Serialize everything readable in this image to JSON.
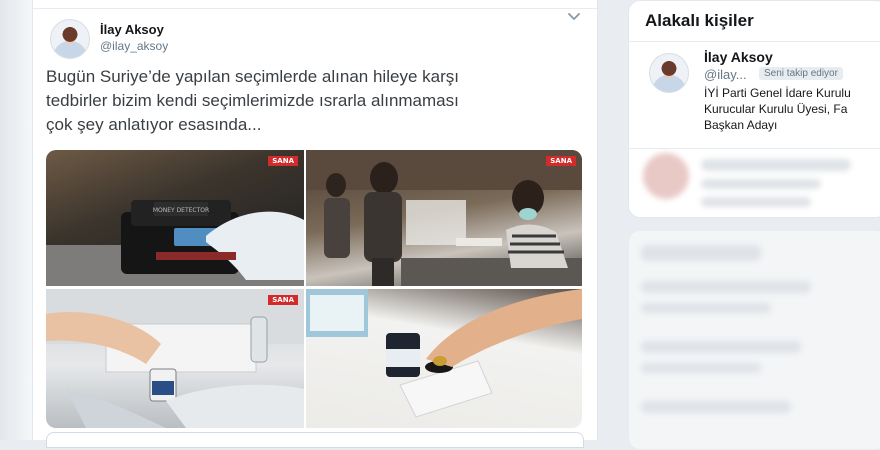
{
  "tweet": {
    "author_name": "İlay Aksoy",
    "author_handle": "@ilay_aksoy",
    "menu_icon": "chevron-down-icon",
    "text_lines": [
      "Bugün Suriye’de yapılan seçimlerde alınan hileye karşı",
      "tedbirler bizim kendi seçimlerimizde ısrarla alınmaması",
      "çok şey anlatıyor esasında..."
    ],
    "media": {
      "watermark": "SANA",
      "device_label_1": "MONEY DETECTOR"
    }
  },
  "sidebar": {
    "title": "Alakalı kişiler",
    "person": {
      "name": "İlay Aksoy",
      "handle": "@ilay...",
      "follows_badge": "Seni takip ediyor",
      "bio_lines": [
        "İYİ Parti Genel İdare Kurulu",
        "Kurucular Kurulu Üyesi, Fa",
        "Başkan Adayı"
      ]
    }
  }
}
